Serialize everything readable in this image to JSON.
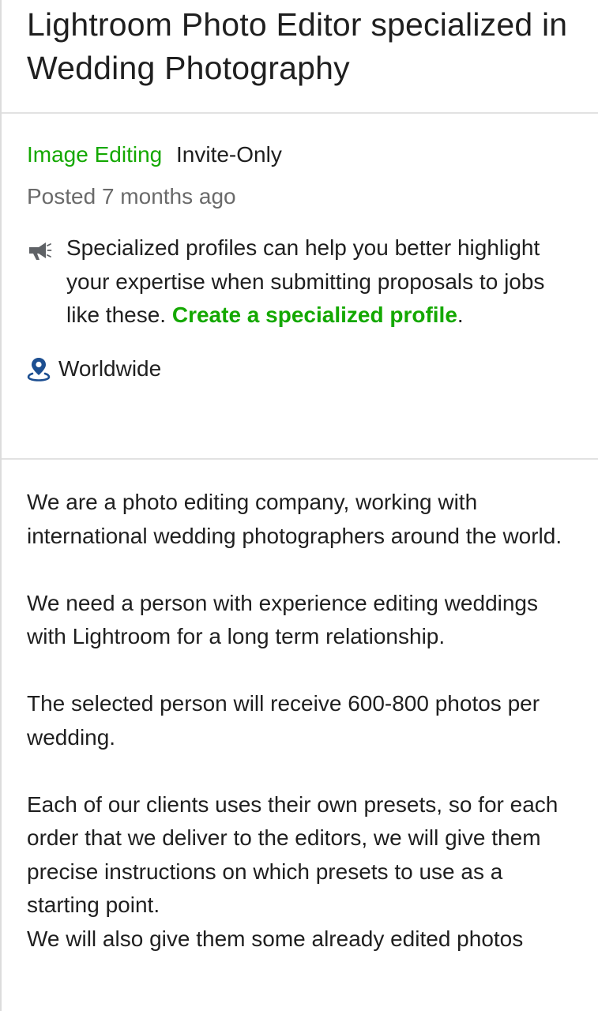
{
  "job": {
    "title": "Lightroom Photo Editor specialized in Wedding Photography",
    "category": "Image Editing",
    "type": "Invite-Only",
    "posted": "Posted 7 months ago",
    "location": "Worldwide"
  },
  "promo": {
    "text": "Specialized profiles can help you better highlight your expertise when submitting proposals to jobs like these. ",
    "link_label": "Create a specialized profile",
    "trailing": "."
  },
  "description": {
    "paragraphs": [
      "We are a photo editing company, working with international wedding photographers around the world.",
      "We need a person with experience editing weddings with Lightroom for a long term relationship.",
      "The selected person will receive 600-800 photos per wedding.",
      "Each of our clients uses their own presets, so for each order that we deliver to the editors, we will give them precise instructions on which presets to use as a starting point.",
      "We will also give them some already edited photos"
    ]
  },
  "icons": {
    "megaphone": "megaphone-icon",
    "location": "location-pin-icon"
  },
  "colors": {
    "accent": "#14a800",
    "text": "#1f1f1f",
    "muted": "#6a6a6a",
    "icon_blue": "#1d4f91"
  }
}
